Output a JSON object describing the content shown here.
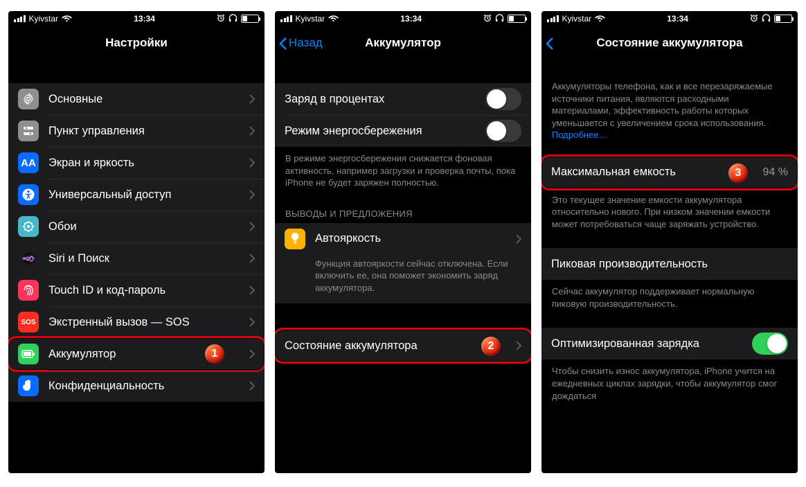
{
  "status": {
    "carrier": "Kyivstar",
    "time": "13:34"
  },
  "screen1": {
    "title": "Настройки",
    "items": [
      {
        "label": "Основные"
      },
      {
        "label": "Пункт управления"
      },
      {
        "label": "Экран и яркость"
      },
      {
        "label": "Универсальный доступ"
      },
      {
        "label": "Обои"
      },
      {
        "label": "Siri и Поиск"
      },
      {
        "label": "Touch ID и код-пароль"
      },
      {
        "label": "Экстренный вызов — SOS"
      },
      {
        "label": "Аккумулятор"
      },
      {
        "label": "Конфиденциальность"
      }
    ],
    "callout_num": "1"
  },
  "screen2": {
    "back": "Назад",
    "title": "Аккумулятор",
    "rows": {
      "percent": "Заряд в процентах",
      "lowpower": "Режим энергосбережения"
    },
    "lowpower_footer": "В режиме энергосбережения снижается фоновая активность, например загрузки и проверка почты, пока iPhone не будет заряжен полностью.",
    "section_header": "ВЫВОДЫ И ПРЕДЛОЖЕНИЯ",
    "autobright": "Автояркость",
    "autobright_footer": "Функция автояркости сейчас отключена. Если включить ее, она поможет экономить заряд аккумулятора.",
    "health": "Состояние аккумулятора",
    "callout_num": "2"
  },
  "screen3": {
    "title": "Состояние аккумулятора",
    "intro": "Аккумуляторы телефона, как и все перезаряжаемые источники питания, являются расходными материалами, эффективность работы которых уменьшается с увеличением срока использования.",
    "learn_more": "Подробнее…",
    "max_cap_label": "Максимальная емкость",
    "max_cap_value": "94 %",
    "max_cap_footer": "Это текущее значение емкости аккумулятора относительно нового. При низком значении емкости может потребоваться чаще заряжать устройство.",
    "peak_label": "Пиковая производительность",
    "peak_footer": "Сейчас аккумулятор поддерживает нормальную пиковую производительность.",
    "opt_label": "Оптимизированная зарядка",
    "opt_footer": "Чтобы снизить износ аккумулятора, iPhone учится на ежедневных циклах зарядки, чтобы аккумулятор смог дождаться",
    "callout_num": "3"
  }
}
